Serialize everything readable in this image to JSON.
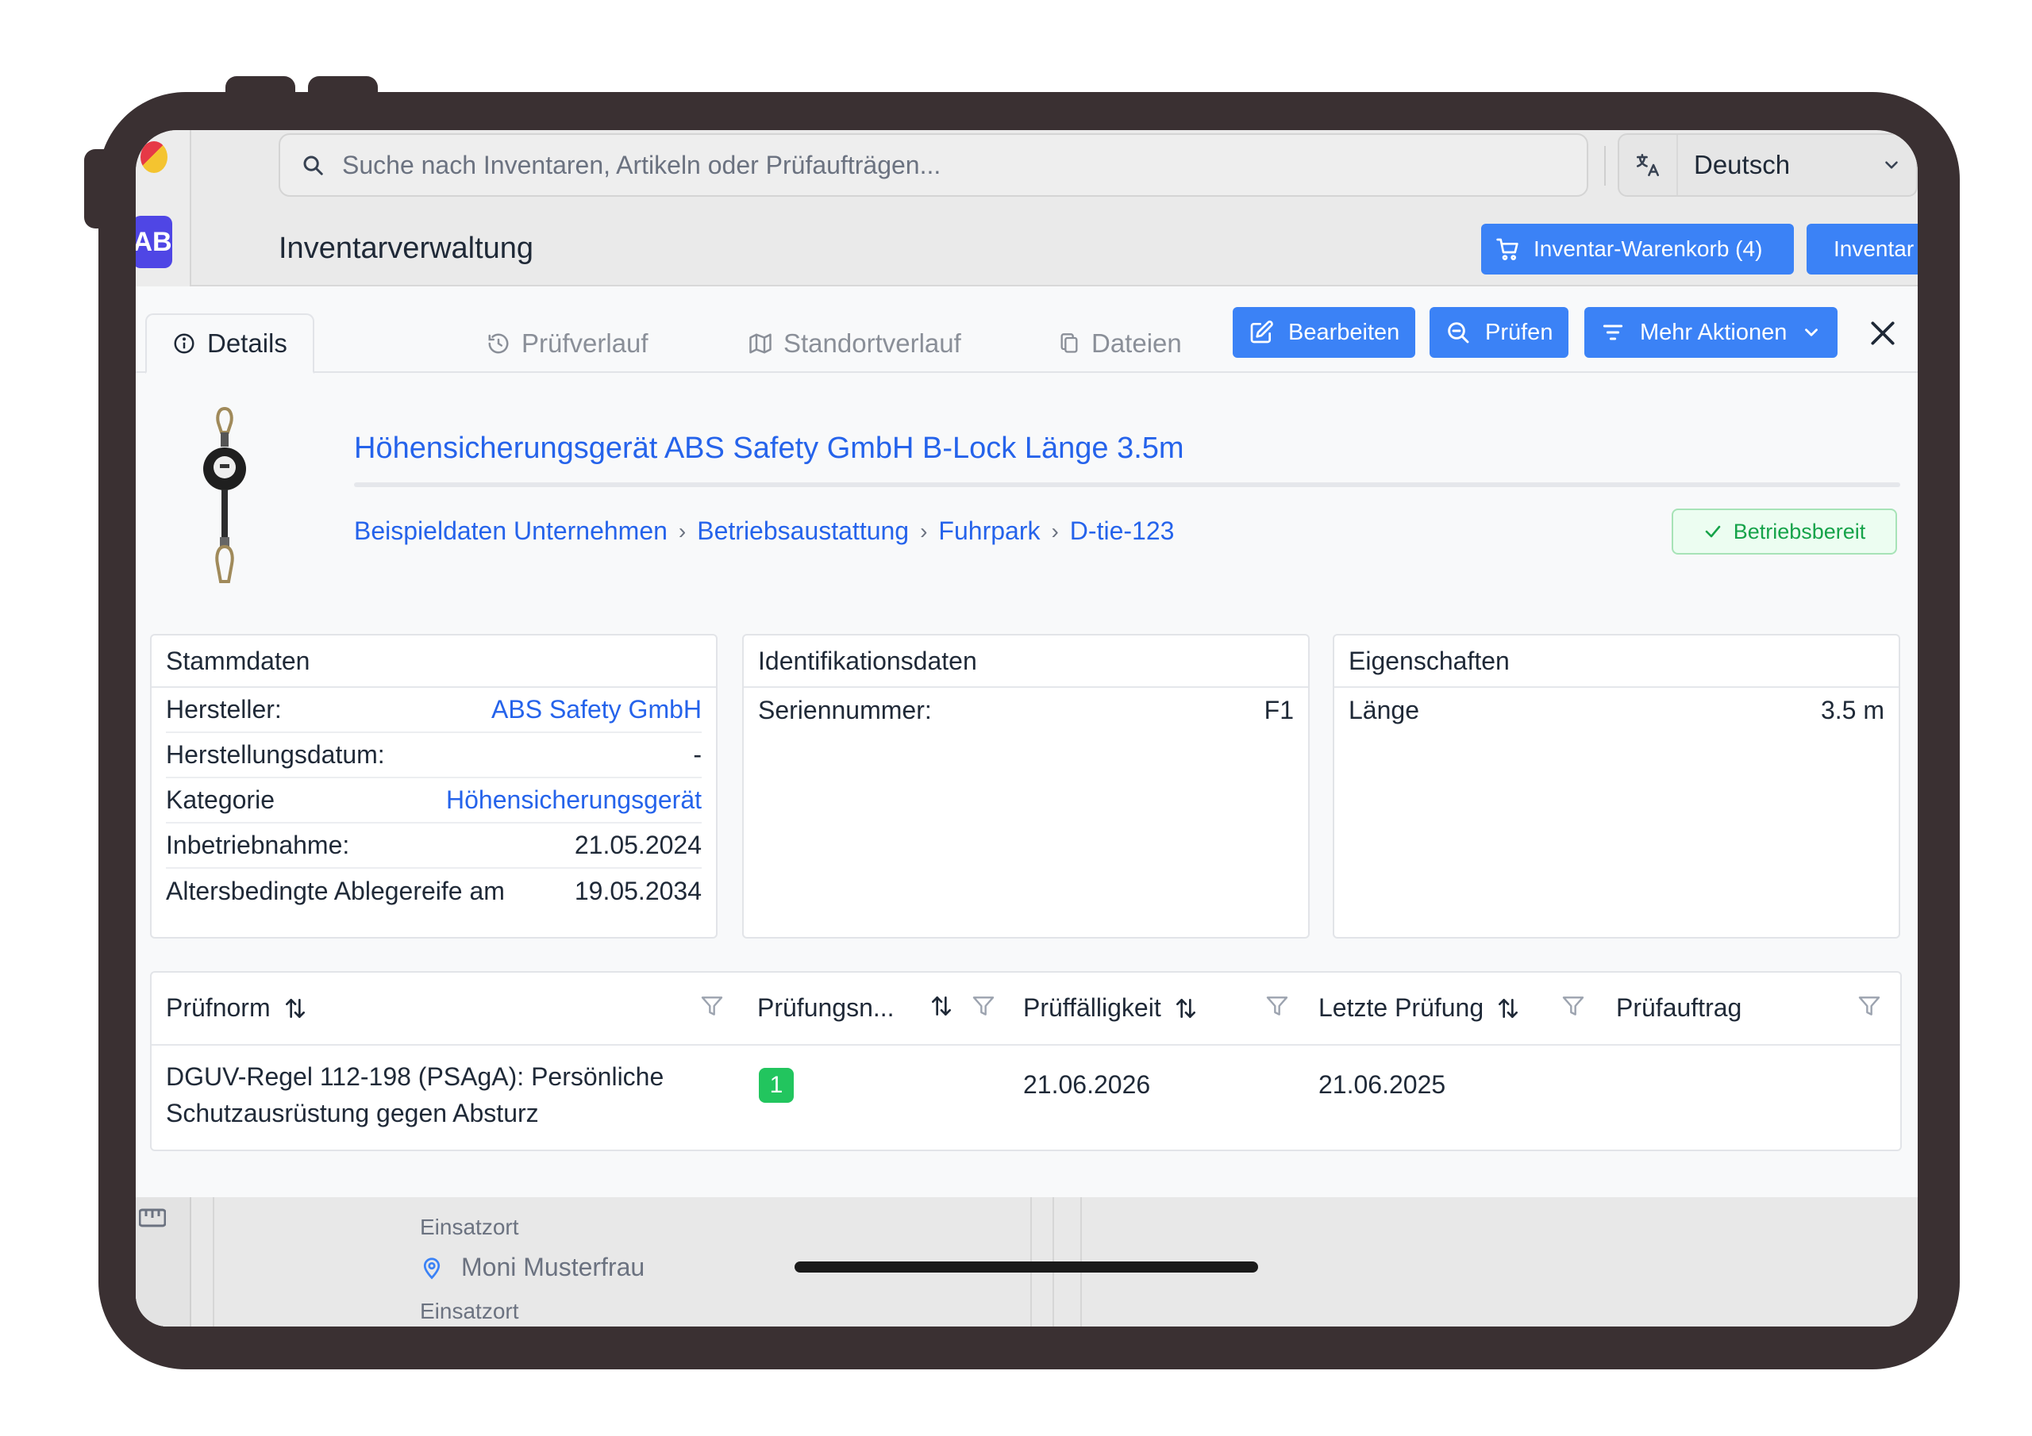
{
  "search": {
    "placeholder": "Suche nach Inventaren, Artikeln oder Prüfaufträgen..."
  },
  "language": {
    "selected": "Deutsch"
  },
  "user": {
    "initials": "AB"
  },
  "header": {
    "title": "Inventarverwaltung",
    "cart_label": "Inventar-Warenkorb (4)",
    "create_label": "Inventar anlegen"
  },
  "tabs": [
    {
      "label": "Details",
      "active": true
    },
    {
      "label": "Prüfverlauf",
      "active": false
    },
    {
      "label": "Standortverlauf",
      "active": false
    },
    {
      "label": "Dateien",
      "active": false
    }
  ],
  "panel_actions": {
    "edit": "Bearbeiten",
    "inspect": "Prüfen",
    "more": "Mehr Aktionen"
  },
  "item": {
    "title": "Höhensicherungsgerät ABS Safety GmbH B-Lock Länge 3.5m",
    "breadcrumb": [
      "Beispieldaten Unternehmen",
      "Betriebsaustattung",
      "Fuhrpark",
      "D-tie-123"
    ],
    "status": "Betriebsbereit"
  },
  "cards": {
    "stammdaten": {
      "title": "Stammdaten",
      "rows": [
        {
          "label": "Hersteller:",
          "value": "ABS Safety GmbH",
          "link": true
        },
        {
          "label": "Herstellungsdatum:",
          "value": "-",
          "link": false
        },
        {
          "label": "Kategorie",
          "value": "Höhensicherungsgerät",
          "link": true
        },
        {
          "label": "Inbetriebnahme:",
          "value": "21.05.2024",
          "link": false
        },
        {
          "label": "Altersbedingte Ablegereife am",
          "value": "19.05.2034",
          "link": false
        }
      ]
    },
    "identifikation": {
      "title": "Identifikationsdaten",
      "rows": [
        {
          "label": "Seriennummer:",
          "value": "F1"
        }
      ]
    },
    "eigenschaften": {
      "title": "Eigenschaften",
      "rows": [
        {
          "label": "Länge",
          "value": "3.5 m"
        }
      ]
    }
  },
  "inspection_table": {
    "columns": [
      "Prüfnorm",
      "Prüfungsn...",
      "Prüffälligkeit",
      "Letzte Prüfung",
      "Prüfauftrag"
    ],
    "rows": [
      {
        "norm_line1": "DGUV-Regel 112-198 (PSAgA): Persönliche",
        "norm_line2": "Schutzausrüstung gegen Absturz",
        "count": "1",
        "due": "21.06.2026",
        "last": "21.06.2025",
        "order": ""
      }
    ]
  },
  "background": {
    "location_label_1": "Einsatzort",
    "person_name": "Moni Musterfrau",
    "location_label_2": "Einsatzort"
  },
  "colors": {
    "accent": "#3b82f6",
    "link": "#2563eb",
    "success": "#16a34a",
    "frame": "#3a3032"
  }
}
